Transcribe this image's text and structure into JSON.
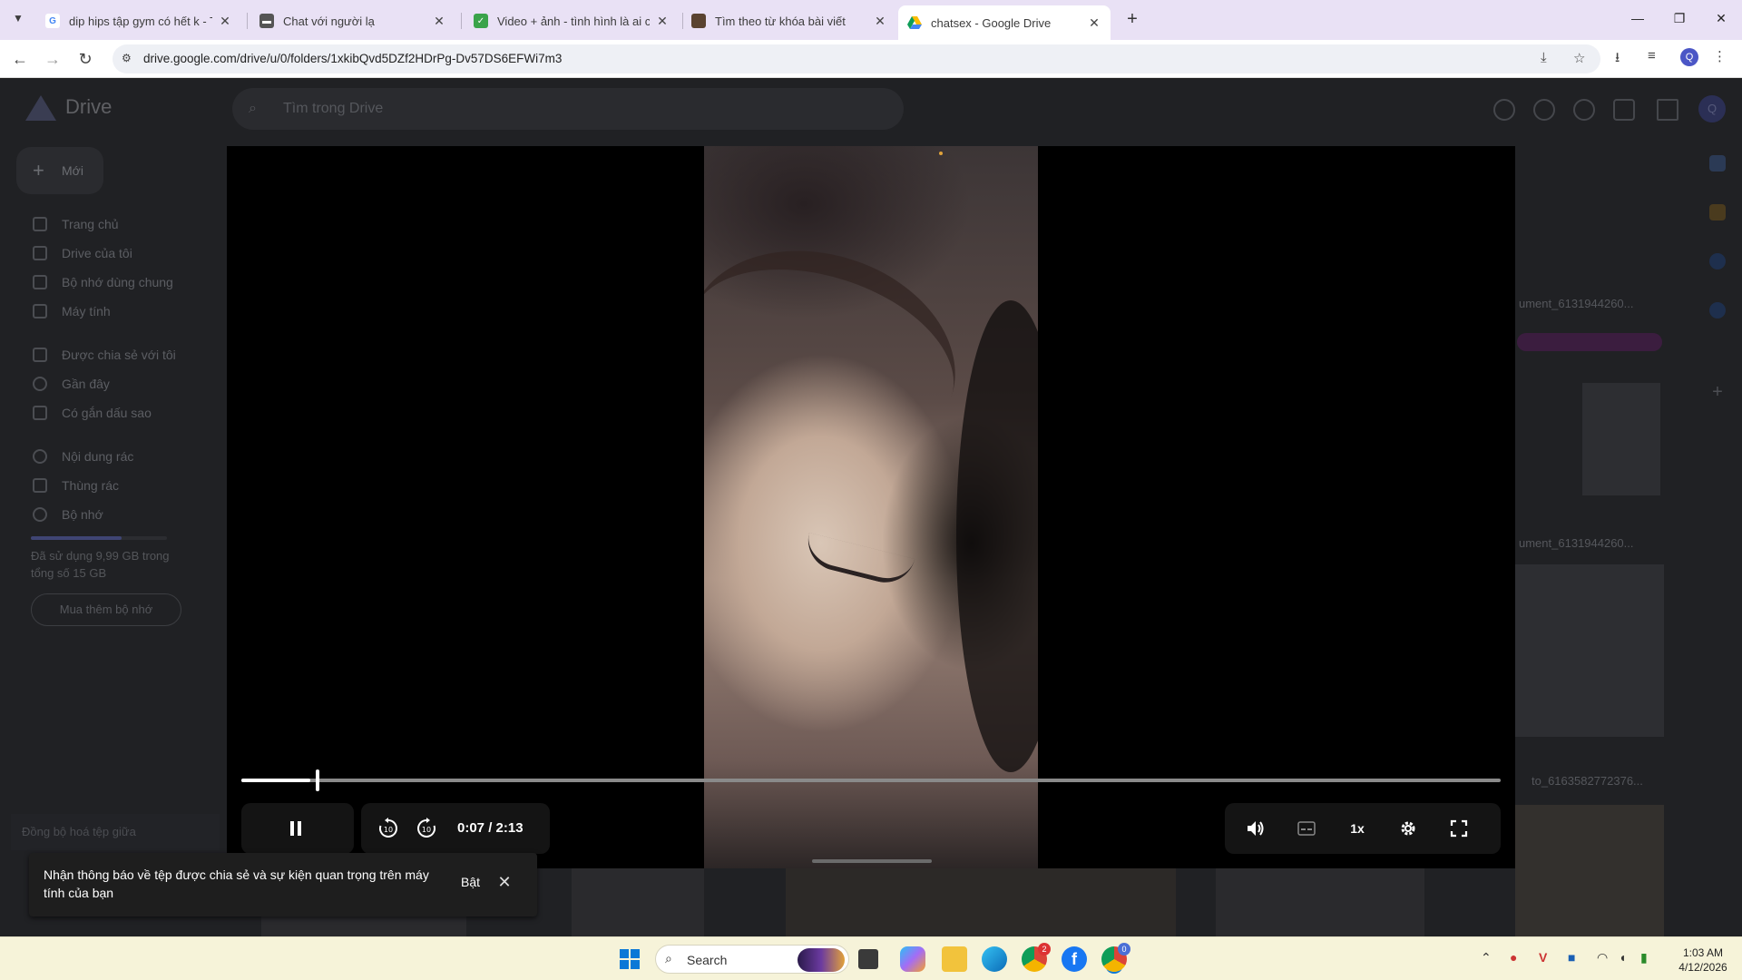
{
  "browser": {
    "tabs": [
      {
        "title": "dip hips tập gym có hết k - Tìm",
        "favicon": "google-g-icon",
        "active": false
      },
      {
        "title": "Chat với người lạ",
        "favicon": "chat-bubble-icon",
        "active": false
      },
      {
        "title": "Video + ảnh - tình hình là ai có",
        "favicon": "checkbox-icon",
        "active": false
      },
      {
        "title": "Tìm theo từ khóa bài viết",
        "favicon": "photo-favicon-icon",
        "active": false
      },
      {
        "title": "chatsex - Google Drive",
        "favicon": "google-drive-icon",
        "active": true
      }
    ],
    "new_tab": "+",
    "url": "drive.google.com/drive/u/0/folders/1xkibQvd5DZf2HDrPg-Dv57DS6EFWi7m3",
    "profile_initial": "Q"
  },
  "drive": {
    "logo_text": "Drive",
    "search_placeholder": "Tìm trong Drive",
    "new_button": "Mới",
    "nav": [
      {
        "label": "Trang chủ",
        "icon": "home-icon"
      },
      {
        "label": "Drive của tôi",
        "icon": "my-drive-icon"
      },
      {
        "label": "Bộ nhớ dùng chung",
        "icon": "shared-drives-icon"
      },
      {
        "label": "Máy tính",
        "icon": "computer-icon"
      },
      {
        "label": "Được chia sẻ với tôi",
        "icon": "shared-with-me-icon"
      },
      {
        "label": "Gần đây",
        "icon": "clock-icon"
      },
      {
        "label": "Có gắn dấu sao",
        "icon": "star-icon"
      },
      {
        "label": "Nội dung rác",
        "icon": "spam-icon"
      },
      {
        "label": "Thùng rác",
        "icon": "trash-icon"
      },
      {
        "label": "Bộ nhớ",
        "icon": "cloud-icon"
      }
    ],
    "storage_text": "Đã sử dụng 9,99 GB trong tổng số 15 GB",
    "storage_used_fraction": 0.666,
    "buy_storage": "Mua thêm bộ nhớ",
    "sync_banner": "Đồng bộ hoá tệp giữa",
    "file_labels": [
      "ument_6131944260...",
      "ument_6131944260...",
      "to_6163582772376..."
    ],
    "profile_initial": "Q"
  },
  "player": {
    "current_time": "0:07",
    "separator": "/",
    "duration": "2:13",
    "progress_fraction": 0.055,
    "speed": "1x",
    "controls": {
      "pause": "pause-icon",
      "rewind": "rewind-10-icon",
      "forward": "forward-10-icon",
      "volume": "volume-icon",
      "captions": "captions-icon",
      "settings": "settings-gear-icon",
      "fullscreen": "fullscreen-icon"
    }
  },
  "toast": {
    "message": "Nhận thông báo về tệp được chia sẻ và sự kiện quan trọng trên máy tính của bạn",
    "action": "Bật"
  },
  "taskbar": {
    "search_label": "Search",
    "time": "1:03 AM",
    "date": "4/12/2026",
    "badges": {
      "chrome": "2",
      "chrome_active": "0"
    }
  }
}
